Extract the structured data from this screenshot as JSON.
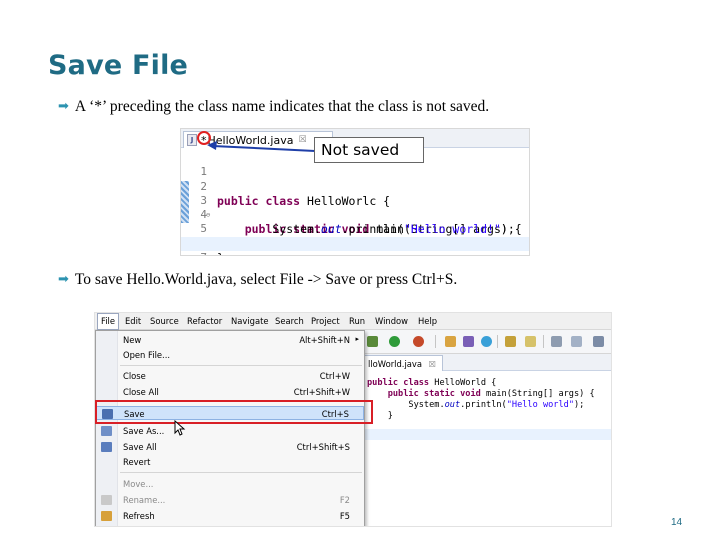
{
  "slide": {
    "title": "Save File",
    "bullet1": "A ‘*’ preceding the class name indicates that the class is not saved.",
    "bullet2": "To save Hello.World.java, select File -> Save or press Ctrl+S.",
    "page_number": "14"
  },
  "editor_shot": {
    "tab_icon": "J",
    "tab_dirty_marker": "*",
    "tab_title": "HelloWorld.java",
    "tab_close": "☒",
    "callout": "Not saved",
    "line_numbers": [
      "1",
      "2",
      "3",
      "4",
      "5",
      "6",
      "7"
    ],
    "code": {
      "l2_kw": "public class",
      "l2_rest": " HelloWorlc {",
      "l3_kw": "public static void",
      "l3_rest": " main(String[] args) {",
      "l4_a": "System.",
      "l4_field": "out",
      "l4_b": ".println(",
      "l4_str": "\"Hello world!\"",
      "l4_c": ");",
      "l5": "}",
      "l6": "}"
    }
  },
  "ide_shot": {
    "menubar": [
      "File",
      "Edit",
      "Source",
      "Refactor",
      "Navigate",
      "Search",
      "Project",
      "Run",
      "Window",
      "Help"
    ],
    "active_menu": "File",
    "menu_items": [
      {
        "label": "New",
        "shortcut": "Alt+Shift+N",
        "submenu": true
      },
      {
        "label": "Open File...",
        "shortcut": ""
      },
      {
        "label": "Close",
        "shortcut": "Ctrl+W"
      },
      {
        "label": "Close All",
        "shortcut": "Ctrl+Shift+W"
      },
      {
        "label": "Save",
        "shortcut": "Ctrl+S",
        "highlighted": true
      },
      {
        "label": "Save As...",
        "shortcut": ""
      },
      {
        "label": "Save All",
        "shortcut": "Ctrl+Shift+S"
      },
      {
        "label": "Revert",
        "shortcut": ""
      },
      {
        "label": "Move...",
        "shortcut": "",
        "disabled": true
      },
      {
        "label": "Rename...",
        "shortcut": "F2",
        "disabled": true
      },
      {
        "label": "Refresh",
        "shortcut": "F5"
      }
    ],
    "submenu_arrow": "▸",
    "editor_tab": "lloWorld.java",
    "editor_tab_close": "☒",
    "code": {
      "l1_kw": "public class",
      "l1_rest": " HelloWorld {",
      "l2_kw": "public static void",
      "l2_rest": " main(String[] args) {",
      "l3_a": "System.",
      "l3_field": "out",
      "l3_b": ".println(",
      "l3_str": "\"Hello world\"",
      "l3_c": ");",
      "l4": "}"
    }
  },
  "colors": {
    "title": "#1f6b84",
    "bullet_mark": "#2c93b0",
    "highlight_box": "#d81f26",
    "keyword": "#7f0055",
    "string": "#2a00ff"
  }
}
